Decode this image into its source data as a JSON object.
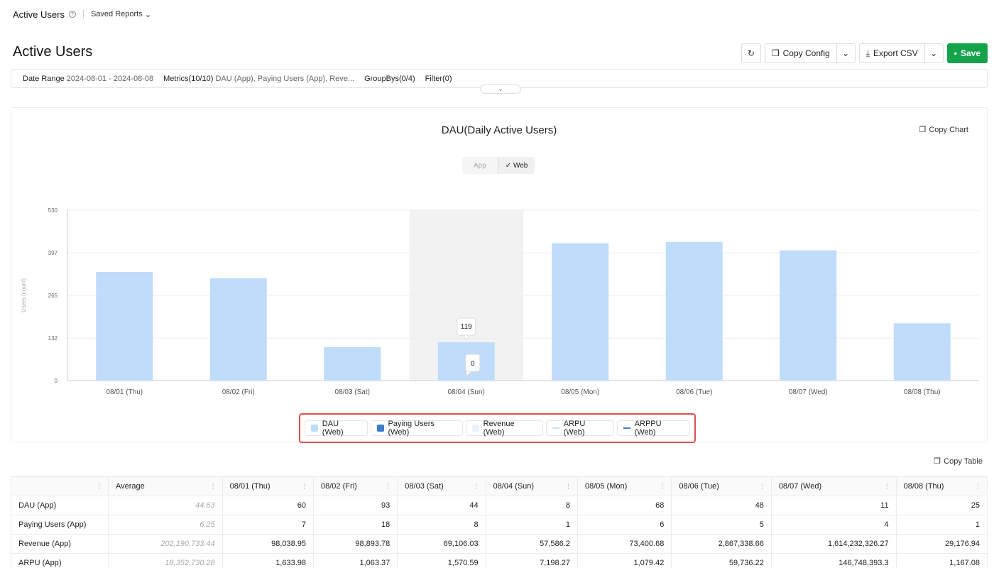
{
  "topbar": {
    "title": "Active Users",
    "saved_reports": "Saved Reports"
  },
  "page_title": "Active Users",
  "toolbar": {
    "copy_config": "Copy Config",
    "export_csv": "Export CSV",
    "save": "Save"
  },
  "filters": {
    "date_range_label": "Date Range",
    "date_range_value": "2024-08-01 - 2024-08-08",
    "metrics_label": "Metrics(10/10)",
    "metrics_value": "DAU (App), Paying Users (App), Reve...",
    "groupbys_label": "GroupBys(0/4)",
    "filter_label": "Filter(0)"
  },
  "chart": {
    "copy_chart": "Copy Chart",
    "toggle": {
      "app": "App",
      "web": "Web"
    },
    "tooltip_values": [
      "119",
      "0"
    ]
  },
  "chart_data": {
    "type": "bar",
    "title": "DAU(Daily Active Users)",
    "ylabel": "Users (count)",
    "ylim": [
      0,
      530
    ],
    "yticks": [
      "0",
      "132",
      "265",
      "397",
      "530"
    ],
    "categories": [
      "08/01 (Thu)",
      "08/02 (Fri)",
      "08/03 (Sat)",
      "08/04 (Sun)",
      "08/05 (Mon)",
      "08/06 (Tue)",
      "08/07 (Wed)",
      "08/08 (Thu)"
    ],
    "series": [
      {
        "name": "DAU (Web)",
        "values": [
          338,
          318,
          104,
          119,
          427,
          431,
          405,
          178
        ],
        "color": "#bfdcfb"
      },
      {
        "name": "Paying Users (Web)",
        "values": [
          0,
          0,
          0,
          0,
          0,
          0,
          0,
          0
        ],
        "color": "#3b7dc9"
      }
    ],
    "highlighted_category": "08/04 (Sun)",
    "grid": true
  },
  "legend": [
    {
      "label": "DAU (Web)",
      "kind": "box",
      "color": "#bfdcfb"
    },
    {
      "label": "Paying Users (Web)",
      "kind": "box",
      "color": "#3b7dc9"
    },
    {
      "label": "Revenue (Web)",
      "kind": "box",
      "color": "#e8f2fd"
    },
    {
      "label": "ARPU (Web)",
      "kind": "line",
      "color": "#c9e0f8"
    },
    {
      "label": "ARPPU (Web)",
      "kind": "line",
      "color": "#3b7dc9"
    }
  ],
  "table": {
    "copy_table": "Copy Table",
    "headers": [
      "",
      "Average",
      "08/01 (Thu)",
      "08/02 (Fri)",
      "08/03 (Sat)",
      "08/04 (Sun)",
      "08/05 (Mon)",
      "08/06 (Tue)",
      "08/07 (Wed)",
      "08/08 (Thu)"
    ],
    "rows": [
      [
        "DAU (App)",
        "44.63",
        "60",
        "93",
        "44",
        "8",
        "68",
        "48",
        "11",
        "25"
      ],
      [
        "Paying Users (App)",
        "6.25",
        "7",
        "18",
        "8",
        "1",
        "6",
        "5",
        "4",
        "1"
      ],
      [
        "Revenue (App)",
        "202,190,733.44",
        "98,038.95",
        "98,893.78",
        "69,106.03",
        "57,586.2",
        "73,400.68",
        "2,867,338.66",
        "1,614,232,326.27",
        "29,176.94"
      ],
      [
        "ARPU (App)",
        "18,352,730.28",
        "1,633.98",
        "1,063.37",
        "1,570.59",
        "7,198.27",
        "1,079.42",
        "59,736.22",
        "146,748,393.3",
        "1,167.08"
      ]
    ]
  }
}
